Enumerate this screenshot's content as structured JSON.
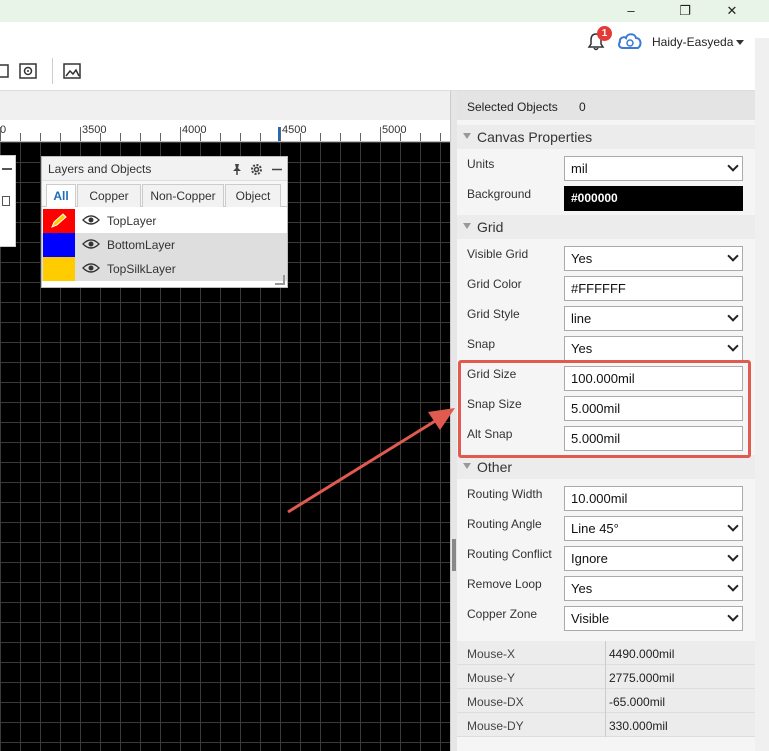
{
  "window": {
    "minimize_glyph": "–",
    "maximize_glyph": "❐",
    "close_glyph": "✕"
  },
  "user": {
    "notification_count": "1",
    "username": "Haidy-Easyeda"
  },
  "ruler": {
    "ticks": [
      "0",
      "3500",
      "4000",
      "4500",
      "5000"
    ]
  },
  "layers_panel": {
    "title": "Layers and Objects",
    "tabs": [
      "All",
      "Copper",
      "Non-Copper",
      "Object"
    ],
    "layers": [
      {
        "name": "TopLayer",
        "color": "#ff0000"
      },
      {
        "name": "BottomLayer",
        "color": "#0000ff"
      },
      {
        "name": "TopSilkLayer",
        "color": "#ffcc00"
      }
    ]
  },
  "properties": {
    "selected_objects_label": "Selected Objects",
    "selected_objects_value": "0",
    "canvas_section": "Canvas Properties",
    "units_label": "Units",
    "units_value": "mil",
    "background_label": "Background",
    "background_value": "#000000",
    "grid_section": "Grid",
    "visible_grid_label": "Visible Grid",
    "visible_grid_value": "Yes",
    "grid_color_label": "Grid Color",
    "grid_color_value": "#FFFFFF",
    "grid_style_label": "Grid Style",
    "grid_style_value": "line",
    "snap_label": "Snap",
    "snap_value": "Yes",
    "grid_size_label": "Grid Size",
    "grid_size_value": "100.000mil",
    "snap_size_label": "Snap Size",
    "snap_size_value": "5.000mil",
    "alt_snap_label": "Alt Snap",
    "alt_snap_value": "5.000mil",
    "other_section": "Other",
    "routing_width_label": "Routing Width",
    "routing_width_value": "10.000mil",
    "routing_angle_label": "Routing Angle",
    "routing_angle_value": "Line 45°",
    "routing_conflict_label": "Routing Conflict",
    "routing_conflict_value": "Ignore",
    "remove_loop_label": "Remove Loop",
    "remove_loop_value": "Yes",
    "copper_zone_label": "Copper Zone",
    "copper_zone_value": "Visible"
  },
  "mouse": [
    {
      "key": "Mouse-X",
      "value": "4490.000mil"
    },
    {
      "key": "Mouse-Y",
      "value": "2775.000mil"
    },
    {
      "key": "Mouse-DX",
      "value": "-65.000mil"
    },
    {
      "key": "Mouse-DY",
      "value": "330.000mil"
    }
  ],
  "colors": {
    "highlight_box": "#e05a4f",
    "active_tab": "#1e6bb8"
  }
}
